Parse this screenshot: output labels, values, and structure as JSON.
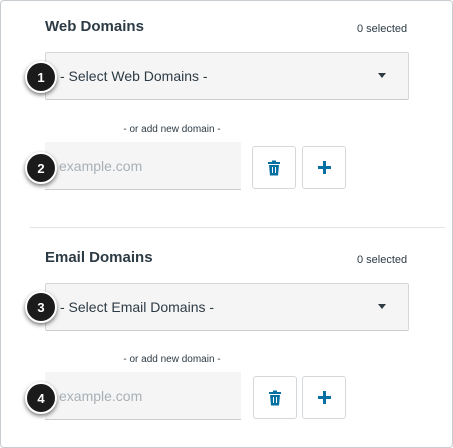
{
  "web": {
    "title": "Web Domains",
    "count": "0 selected",
    "select_label": "- Select Web Domains -",
    "or_add": "- or add new domain -",
    "input_placeholder": "example.com",
    "badge_select": "1",
    "badge_input": "2"
  },
  "email": {
    "title": "Email Domains",
    "count": "0 selected",
    "select_label": "- Select Email Domains -",
    "or_add": "- or add new domain -",
    "input_placeholder": "example.com",
    "badge_select": "3",
    "badge_input": "4"
  },
  "icons": {
    "delete": "trash-icon",
    "add": "plus-icon",
    "dropdown": "caret-down-icon"
  },
  "colors": {
    "accent": "#0770a3",
    "text": "#2d3b45",
    "field_bg": "#f5f5f5",
    "badge_bg": "#1b1b1b"
  }
}
